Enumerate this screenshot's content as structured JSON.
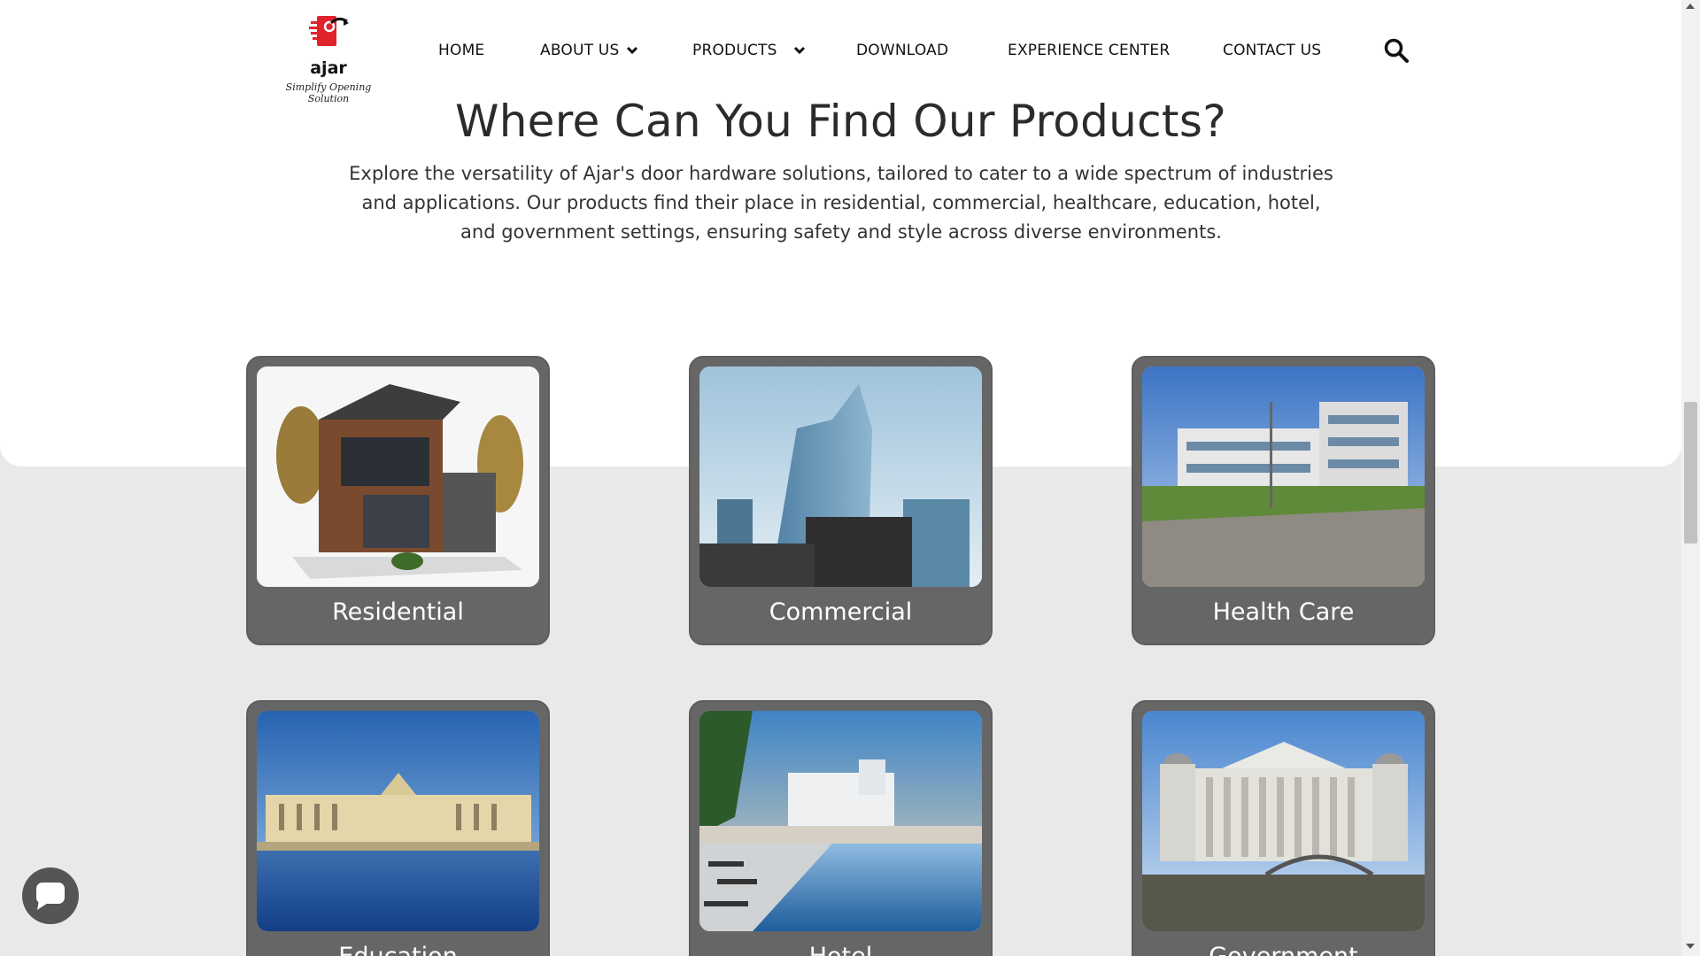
{
  "brand": {
    "name": "ajar",
    "tagline": "Simplify Opening Solution",
    "logo_icon": "ajar-logo-icon",
    "accent_color": "#e0232b"
  },
  "nav": {
    "items": [
      {
        "label": "HOME",
        "has_dropdown": false
      },
      {
        "label": "ABOUT US",
        "has_dropdown": true
      },
      {
        "label": "PRODUCTS",
        "has_dropdown": true
      },
      {
        "label": "DOWNLOAD",
        "has_dropdown": false
      },
      {
        "label": "EXPERIENCE CENTER",
        "has_dropdown": false
      },
      {
        "label": "CONTACT US",
        "has_dropdown": false
      }
    ],
    "search_icon": "search-icon"
  },
  "section": {
    "title": "Where Can You Find Our Products?",
    "description": "Explore the versatility of Ajar's door hardware solutions, tailored to cater to a wide spectrum of industries and applications. Our products find their place in residential, commercial, healthcare, education, hotel, and government settings, ensuring safety and style across diverse environments."
  },
  "categories": [
    {
      "label": "Residential",
      "image": "modern-house-photo"
    },
    {
      "label": "Commercial",
      "image": "glass-skyscraper-photo"
    },
    {
      "label": "Health Care",
      "image": "hospital-building-photo"
    },
    {
      "label": "Education",
      "image": "university-building-riverside-photo"
    },
    {
      "label": "Hotel",
      "image": "resort-pool-photo"
    },
    {
      "label": "Government",
      "image": "government-colonnade-building-photo"
    }
  ],
  "chat": {
    "icon": "chat-bubble-icon"
  },
  "colors": {
    "card_bg": "#666666",
    "page_bg": "#e9e9e9",
    "panel_bg": "#ffffff"
  }
}
